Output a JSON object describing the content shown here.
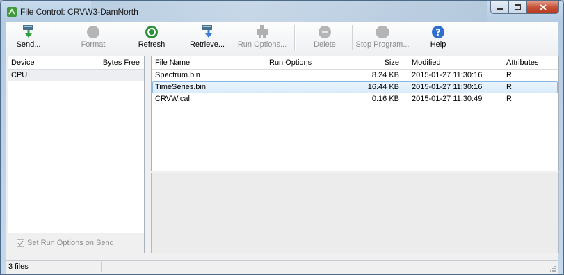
{
  "window": {
    "title": "File Control: CRVW3-DamNorth"
  },
  "toolbar": {
    "send": "Send...",
    "format": "Format",
    "refresh": "Refresh",
    "retrieve": "Retrieve...",
    "run_options": "Run Options...",
    "delete": "Delete",
    "stop_program": "Stop Program...",
    "help": "Help"
  },
  "devices": {
    "col_device": "Device",
    "col_bytes_free": "Bytes Free",
    "rows": [
      {
        "device": "CPU",
        "bytes_free": ""
      }
    ]
  },
  "set_run_options_on_send": {
    "label": "Set Run Options on Send",
    "checked": true
  },
  "files": {
    "col_name": "File Name",
    "col_run_options": "Run Options",
    "col_size": "Size",
    "col_modified": "Modified",
    "col_attributes": "Attributes",
    "rows": [
      {
        "name": "Spectrum.bin",
        "run_options": "",
        "size": "8.24 KB",
        "modified": "2015-01-27 11:30:16",
        "attributes": "R"
      },
      {
        "name": "TimeSeries.bin",
        "run_options": "",
        "size": "16.44 KB",
        "modified": "2015-01-27 11:30:16",
        "attributes": "R",
        "selected": true
      },
      {
        "name": "CRVW.cal",
        "run_options": "",
        "size": "0.16 KB",
        "modified": "2015-01-27 11:30:49",
        "attributes": "R"
      }
    ]
  },
  "status": {
    "text": "3 files"
  },
  "colors": {
    "selection_bg": "#dbecfc",
    "selection_border": "#89b8e6",
    "close_button": "#c7533a"
  }
}
